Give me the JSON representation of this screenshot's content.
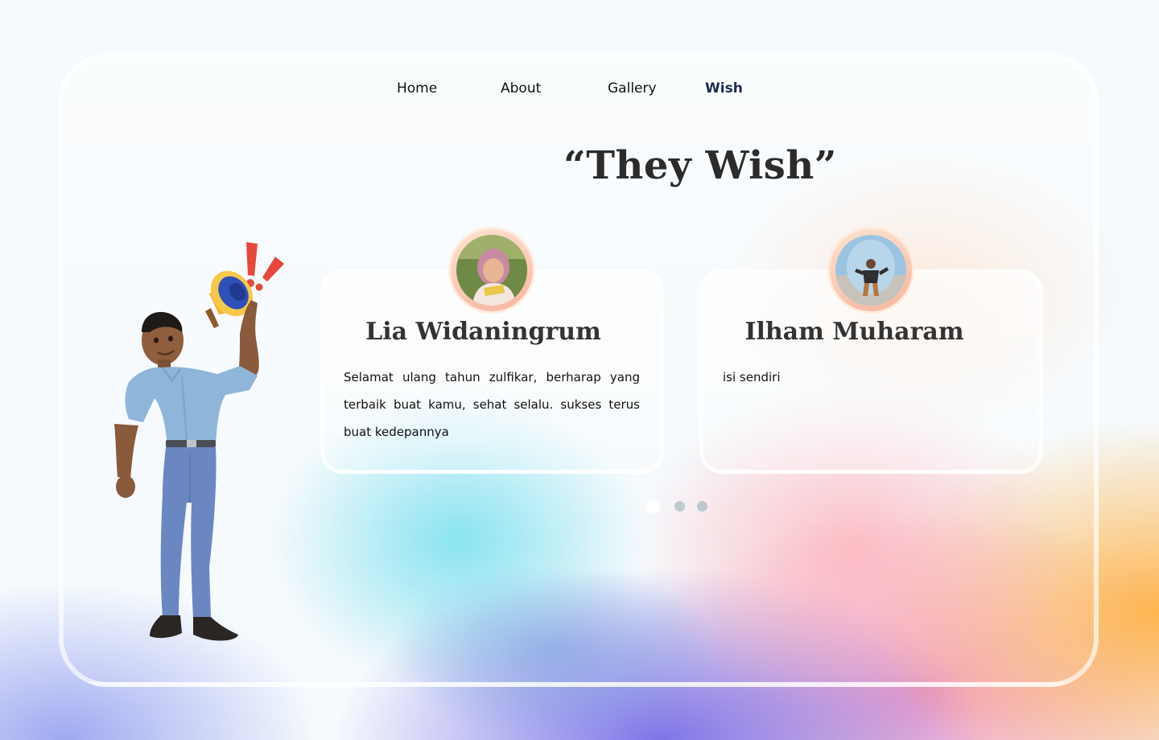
{
  "nav": {
    "items": [
      {
        "label": "Home"
      },
      {
        "label": "About"
      },
      {
        "label": "Gallery"
      },
      {
        "label": "Wish"
      }
    ],
    "active": "Wish"
  },
  "page": {
    "title": "“They Wish”"
  },
  "wishes": [
    {
      "name": "Lia Widaningrum",
      "message": "Selamat ulang tahun zulfikar, berharap yang terbaik buat kamu, sehat selalu. sukses terus buat kedepannya"
    },
    {
      "name": "Ilham Muharam",
      "message": "isi sendiri"
    }
  ],
  "carousel": {
    "page_count": 3,
    "active_index": 0
  },
  "colors": {
    "active_nav": "#1b2a55",
    "title": "#2b2b2b",
    "active_dot": "#ffffff",
    "inactive_dot": "#aabec3"
  },
  "illustration": {
    "icon": "megaphone-man-illustration"
  }
}
